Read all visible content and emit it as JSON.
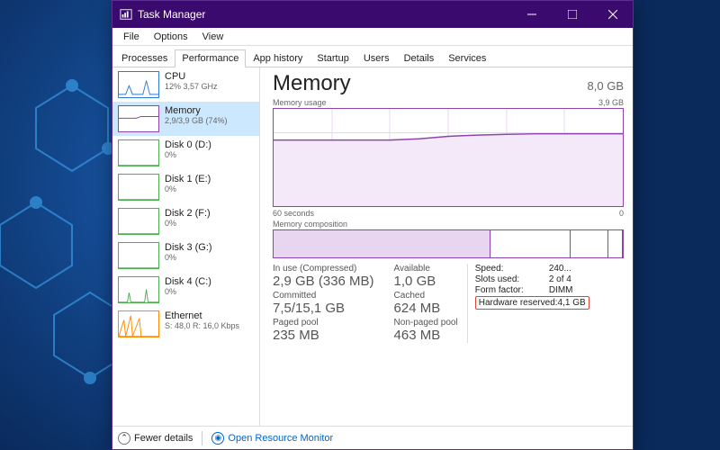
{
  "window": {
    "title": "Task Manager",
    "menus": [
      "File",
      "Options",
      "View"
    ],
    "tabs": [
      "Processes",
      "Performance",
      "App history",
      "Startup",
      "Users",
      "Details",
      "Services"
    ],
    "active_tab": 1
  },
  "sidebar": {
    "items": [
      {
        "name": "CPU",
        "sub": "12%  3,57 GHz",
        "color": "#2b7cd3",
        "spark": "cpu"
      },
      {
        "name": "Memory",
        "sub": "2,9/3,9 GB (74%)",
        "color": "#8e44ad",
        "spark": "mem",
        "selected": true
      },
      {
        "name": "Disk 0 (D:)",
        "sub": "0%",
        "color": "#4caf50",
        "spark": "flat"
      },
      {
        "name": "Disk 1 (E:)",
        "sub": "0%",
        "color": "#4caf50",
        "spark": "flat"
      },
      {
        "name": "Disk 2 (F:)",
        "sub": "0%",
        "color": "#4caf50",
        "spark": "flat"
      },
      {
        "name": "Disk 3 (G:)",
        "sub": "0%",
        "color": "#4caf50",
        "spark": "flat"
      },
      {
        "name": "Disk 4 (C:)",
        "sub": "0%",
        "color": "#4caf50",
        "spark": "disk4"
      },
      {
        "name": "Ethernet",
        "sub": "S: 48,0  R: 16,0 Kbps",
        "color": "#ff8c00",
        "spark": "net"
      }
    ]
  },
  "memory": {
    "title": "Memory",
    "total": "8,0 GB",
    "usage_label": "Memory usage",
    "usage_max": "3,9 GB",
    "xaxis_left": "60 seconds",
    "xaxis_right": "0",
    "composition_label": "Memory composition",
    "composition_segments": [
      62,
      23,
      11,
      4
    ],
    "stats": {
      "in_use_label": "In use (Compressed)",
      "in_use": "2,9 GB (336 MB)",
      "available_label": "Available",
      "available": "1,0 GB",
      "committed_label": "Committed",
      "committed": "7,5/15,1 GB",
      "cached_label": "Cached",
      "cached": "624 MB",
      "paged_label": "Paged pool",
      "paged": "235 MB",
      "nonpaged_label": "Non-paged pool",
      "nonpaged": "463 MB"
    },
    "right": {
      "speed_label": "Speed:",
      "speed": "240...",
      "slots_label": "Slots used:",
      "slots": "2 of 4",
      "form_label": "Form factor:",
      "form": "DIMM",
      "hw_label": "Hardware reserved:",
      "hw": "4,1 GB"
    }
  },
  "footer": {
    "fewer": "Fewer details",
    "rmon": "Open Resource Monitor"
  },
  "chart_data": {
    "type": "area",
    "title": "Memory usage",
    "ylabel": "GB",
    "ylim": [
      0,
      3.9
    ],
    "x": [
      60,
      55,
      50,
      45,
      40,
      35,
      30,
      25,
      20,
      15,
      10,
      5,
      0
    ],
    "series": [
      {
        "name": "In use",
        "values": [
          2.65,
          2.65,
          2.65,
          2.65,
          2.65,
          2.7,
          2.8,
          2.85,
          2.88,
          2.9,
          2.9,
          2.9,
          2.9
        ]
      }
    ]
  }
}
